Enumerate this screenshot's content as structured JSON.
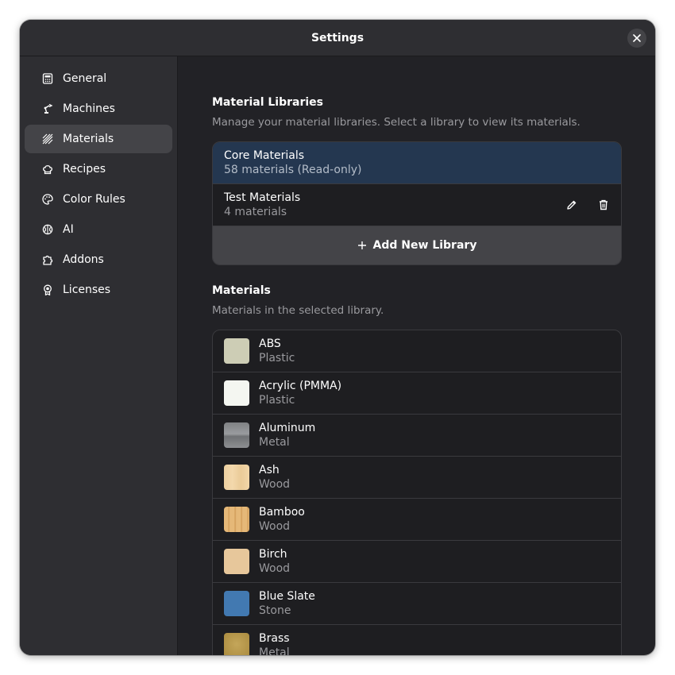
{
  "window": {
    "title": "Settings"
  },
  "sidebar": {
    "items": [
      {
        "label": "General",
        "icon": "calculator-icon"
      },
      {
        "label": "Machines",
        "icon": "robot-arm-icon"
      },
      {
        "label": "Materials",
        "icon": "hatch-pattern-icon",
        "active": true
      },
      {
        "label": "Recipes",
        "icon": "chef-hat-icon"
      },
      {
        "label": "Color Rules",
        "icon": "palette-icon"
      },
      {
        "label": "AI",
        "icon": "brain-icon"
      },
      {
        "label": "Addons",
        "icon": "puzzle-icon"
      },
      {
        "label": "Licenses",
        "icon": "certificate-icon"
      }
    ]
  },
  "libraries": {
    "title": "Material Libraries",
    "description": "Manage your material libraries. Select a library to view its materials.",
    "items": [
      {
        "name": "Core Materials",
        "subtitle": "58 materials (Read-only)",
        "selected": true
      },
      {
        "name": "Test Materials",
        "subtitle": "4 materials",
        "selected": false
      }
    ],
    "add_label": "Add New Library"
  },
  "materials": {
    "title": "Materials",
    "description": "Materials in the selected library.",
    "items": [
      {
        "name": "ABS",
        "category": "Plastic",
        "color": "#cdcdb5"
      },
      {
        "name": "Acrylic (PMMA)",
        "category": "Plastic",
        "color": "#f4f6f1"
      },
      {
        "name": "Aluminum",
        "category": "Metal",
        "color": "#8a8c8f"
      },
      {
        "name": "Ash",
        "category": "Wood",
        "color": "#f0d4a6"
      },
      {
        "name": "Bamboo",
        "category": "Wood",
        "color": "#e2b371"
      },
      {
        "name": "Birch",
        "category": "Wood",
        "color": "#e7c79b"
      },
      {
        "name": "Blue Slate",
        "category": "Stone",
        "color": "#4279b1"
      },
      {
        "name": "Brass",
        "category": "Metal",
        "color": "#b99b4a"
      }
    ]
  },
  "colors": {
    "window_bg": "#222226",
    "sidebar_bg": "#2e2e32",
    "selected_row": "#243750",
    "active_nav": "#444448"
  }
}
